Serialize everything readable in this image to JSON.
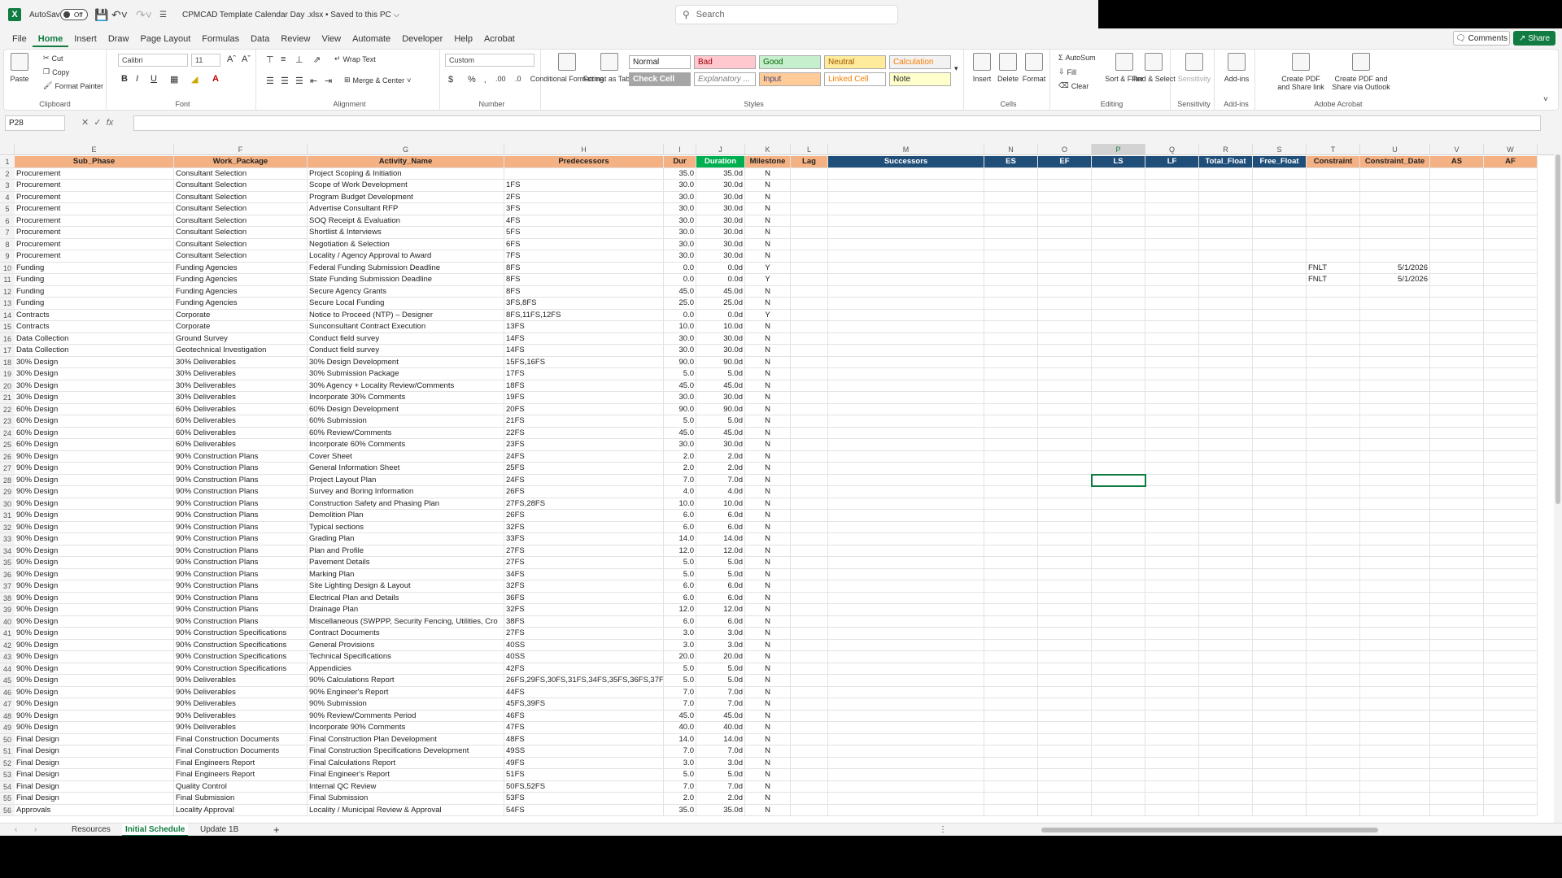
{
  "titlebar": {
    "app_logo": "X",
    "autosave_label": "AutoSave",
    "autosave_state": "Off",
    "doc_title": "CPMCAD Template Calendar Day .xlsx • Saved to this PC ⌵",
    "search_placeholder": "Search",
    "comments": "Comments",
    "share": "Share"
  },
  "menu": [
    "File",
    "Home",
    "Insert",
    "Draw",
    "Page Layout",
    "Formulas",
    "Data",
    "Review",
    "View",
    "Automate",
    "Developer",
    "Help",
    "Acrobat"
  ],
  "ribbon": {
    "clipboard": {
      "paste": "Paste",
      "cut": "Cut",
      "copy": "Copy",
      "format_painter": "Format Painter",
      "label": "Clipboard"
    },
    "font": {
      "name": "Calibri",
      "size": "11",
      "label": "Font"
    },
    "alignment": {
      "wrap": "Wrap Text",
      "merge": "Merge & Center",
      "label": "Alignment"
    },
    "number": {
      "format": "Custom",
      "label": "Number"
    },
    "styles": {
      "cond": "Conditional Formatting",
      "table": "Format as Table",
      "label": "Styles",
      "cells": [
        "Normal",
        "Bad",
        "Good",
        "Neutral",
        "Calculation",
        "Check Cell",
        "Explanatory ...",
        "Input",
        "Linked Cell",
        "Note"
      ]
    },
    "cells": {
      "insert": "Insert",
      "delete": "Delete",
      "format": "Format",
      "label": "Cells"
    },
    "editing": {
      "autosum": "AutoSum",
      "fill": "Fill",
      "clear": "Clear",
      "sort": "Sort & Filter",
      "find": "Find & Select",
      "label": "Editing"
    },
    "sensitivity": {
      "btn": "Sensitivity",
      "label": "Sensitivity"
    },
    "addins": {
      "btn": "Add-ins",
      "label": "Add-ins"
    },
    "acrobat": {
      "pdf": "Create PDF and Share link",
      "pdf_outlook": "Create PDF and Share via Outlook",
      "label": "Adobe Acrobat"
    }
  },
  "formula_bar": {
    "namebox": "P28",
    "fx": "fx"
  },
  "columns": [
    "E",
    "F",
    "G",
    "H",
    "I",
    "J",
    "K",
    "L",
    "M",
    "N",
    "O",
    "P",
    "Q",
    "R",
    "S",
    "T",
    "U",
    "V",
    "W"
  ],
  "headers": [
    "Sub_Phase",
    "Work_Package",
    "Activity_Name",
    "Predecessors",
    "Dur",
    "Duration",
    "Milestone",
    "Lag",
    "Successors",
    "ES",
    "EF",
    "LS",
    "LF",
    "Total_Float",
    "Free_Float",
    "Constraint",
    "Constraint_Date",
    "AS",
    "AF"
  ],
  "rows": [
    [
      "Procurement",
      "Consultant Selection",
      "Project Scoping & Initiation",
      "",
      "35.0",
      "35.0d",
      "N"
    ],
    [
      "Procurement",
      "Consultant Selection",
      "Scope of Work Development",
      "1FS",
      "30.0",
      "30.0d",
      "N"
    ],
    [
      "Procurement",
      "Consultant Selection",
      "Program Budget Development",
      "2FS",
      "30.0",
      "30.0d",
      "N"
    ],
    [
      "Procurement",
      "Consultant Selection",
      "Advertise Consultant RFP",
      "3FS",
      "30.0",
      "30.0d",
      "N"
    ],
    [
      "Procurement",
      "Consultant Selection",
      "SOQ Receipt & Evaluation",
      "4FS",
      "30.0",
      "30.0d",
      "N"
    ],
    [
      "Procurement",
      "Consultant Selection",
      "Shortlist & Interviews",
      "5FS",
      "30.0",
      "30.0d",
      "N"
    ],
    [
      "Procurement",
      "Consultant Selection",
      "Negotiation & Selection",
      "6FS",
      "30.0",
      "30.0d",
      "N"
    ],
    [
      "Procurement",
      "Consultant Selection",
      "Locality / Agency Approval to Award",
      "7FS",
      "30.0",
      "30.0d",
      "N"
    ],
    [
      "Funding",
      "Funding Agencies",
      "Federal Funding Submission Deadline",
      "8FS",
      "0.0",
      "0.0d",
      "Y",
      "FNLT",
      "5/1/2026"
    ],
    [
      "Funding",
      "Funding Agencies",
      "State Funding Submission Deadline",
      "8FS",
      "0.0",
      "0.0d",
      "Y",
      "FNLT",
      "5/1/2026"
    ],
    [
      "Funding",
      "Funding Agencies",
      "Secure Agency Grants",
      "8FS",
      "45.0",
      "45.0d",
      "N"
    ],
    [
      "Funding",
      "Funding Agencies",
      "Secure Local Funding",
      "3FS,8FS",
      "25.0",
      "25.0d",
      "N"
    ],
    [
      "Contracts",
      "Corporate",
      "Notice to Proceed (NTP) – Designer",
      "8FS,11FS,12FS",
      "0.0",
      "0.0d",
      "Y"
    ],
    [
      "Contracts",
      "Corporate",
      "Sunconsultant Contract Execution",
      "13FS",
      "10.0",
      "10.0d",
      "N"
    ],
    [
      "Data Collection",
      "Ground Survey",
      "Conduct field survey",
      "14FS",
      "30.0",
      "30.0d",
      "N"
    ],
    [
      "Data Collection",
      "Geotechnical Investigation",
      "Conduct field survey",
      "14FS",
      "30.0",
      "30.0d",
      "N"
    ],
    [
      "30% Design",
      "30% Deliverables",
      "30% Design Development",
      "15FS,16FS",
      "90.0",
      "90.0d",
      "N"
    ],
    [
      "30% Design",
      "30% Deliverables",
      "30% Submission Package",
      "17FS",
      "5.0",
      "5.0d",
      "N"
    ],
    [
      "30% Design",
      "30% Deliverables",
      "30% Agency + Locality Review/Comments",
      "18FS",
      "45.0",
      "45.0d",
      "N"
    ],
    [
      "30% Design",
      "30% Deliverables",
      "Incorporate 30% Comments",
      "19FS",
      "30.0",
      "30.0d",
      "N"
    ],
    [
      "60% Design",
      "60% Deliverables",
      "60% Design Development",
      "20FS",
      "90.0",
      "90.0d",
      "N"
    ],
    [
      "60% Design",
      "60% Deliverables",
      "60% Submission",
      "21FS",
      "5.0",
      "5.0d",
      "N"
    ],
    [
      "60% Design",
      "60% Deliverables",
      "60% Review/Comments",
      "22FS",
      "45.0",
      "45.0d",
      "N"
    ],
    [
      "60% Design",
      "60% Deliverables",
      "Incorporate 60% Comments",
      "23FS",
      "30.0",
      "30.0d",
      "N"
    ],
    [
      "90% Design",
      "90% Construction Plans",
      "Cover Sheet",
      "24FS",
      "2.0",
      "2.0d",
      "N"
    ],
    [
      "90% Design",
      "90% Construction Plans",
      "General Information Sheet",
      "25FS",
      "2.0",
      "2.0d",
      "N"
    ],
    [
      "90% Design",
      "90% Construction Plans",
      "Project Layout Plan",
      "24FS",
      "7.0",
      "7.0d",
      "N"
    ],
    [
      "90% Design",
      "90% Construction Plans",
      "Survey and Boring Information",
      "26FS",
      "4.0",
      "4.0d",
      "N"
    ],
    [
      "90% Design",
      "90% Construction Plans",
      "Construction Safety and Phasing Plan",
      "27FS,28FS",
      "10.0",
      "10.0d",
      "N"
    ],
    [
      "90% Design",
      "90% Construction Plans",
      "Demolition Plan",
      "26FS",
      "6.0",
      "6.0d",
      "N"
    ],
    [
      "90% Design",
      "90% Construction Plans",
      "Typical sections",
      "32FS",
      "6.0",
      "6.0d",
      "N"
    ],
    [
      "90% Design",
      "90% Construction Plans",
      "Grading Plan",
      "33FS",
      "14.0",
      "14.0d",
      "N"
    ],
    [
      "90% Design",
      "90% Construction Plans",
      "Plan and Profile",
      "27FS",
      "12.0",
      "12.0d",
      "N"
    ],
    [
      "90% Design",
      "90% Construction Plans",
      "Pavement Details",
      "27FS",
      "5.0",
      "5.0d",
      "N"
    ],
    [
      "90% Design",
      "90% Construction Plans",
      "Marking Plan",
      "34FS",
      "5.0",
      "5.0d",
      "N"
    ],
    [
      "90% Design",
      "90% Construction Plans",
      "Site Lighting Design & Layout",
      "32FS",
      "6.0",
      "6.0d",
      "N"
    ],
    [
      "90% Design",
      "90% Construction Plans",
      "Electrical Plan and Details",
      "36FS",
      "6.0",
      "6.0d",
      "N"
    ],
    [
      "90% Design",
      "90% Construction Plans",
      "Drainage Plan",
      "32FS",
      "12.0",
      "12.0d",
      "N"
    ],
    [
      "90% Design",
      "90% Construction Plans",
      "Miscellaneous (SWPPP, Security Fencing, Utilities, Cro",
      "38FS",
      "6.0",
      "6.0d",
      "N"
    ],
    [
      "90% Design",
      "90% Construction Specifications",
      "Contract Documents",
      "27FS",
      "3.0",
      "3.0d",
      "N"
    ],
    [
      "90% Design",
      "90% Construction Specifications",
      "General Provisions",
      "40SS",
      "3.0",
      "3.0d",
      "N"
    ],
    [
      "90% Design",
      "90% Construction Specifications",
      "Technical Specifications",
      "40SS",
      "20.0",
      "20.0d",
      "N"
    ],
    [
      "90% Design",
      "90% Construction Specifications",
      "Appendicies",
      "42FS",
      "5.0",
      "5.0d",
      "N"
    ],
    [
      "90% Design",
      "90% Deliverables",
      "90% Calculations Report",
      "26FS,29FS,30FS,31FS,34FS,35FS,36FS,37FS,3",
      "5.0",
      "5.0d",
      "N"
    ],
    [
      "90% Design",
      "90% Deliverables",
      "90% Engineer's Report",
      "44FS",
      "7.0",
      "7.0d",
      "N"
    ],
    [
      "90% Design",
      "90% Deliverables",
      "90% Submission",
      "45FS,39FS",
      "7.0",
      "7.0d",
      "N"
    ],
    [
      "90% Design",
      "90% Deliverables",
      "90% Review/Comments Period",
      "46FS",
      "45.0",
      "45.0d",
      "N"
    ],
    [
      "90% Design",
      "90% Deliverables",
      "Incorporate 90% Comments",
      "47FS",
      "40.0",
      "40.0d",
      "N"
    ],
    [
      "Final Design",
      "Final Construction Documents",
      "Final Construction Plan Development",
      "48FS",
      "14.0",
      "14.0d",
      "N"
    ],
    [
      "Final Design",
      "Final Construction Documents",
      "Final Construction Specifications Development",
      "49SS",
      "7.0",
      "7.0d",
      "N"
    ],
    [
      "Final Design",
      "Final Engineers Report",
      "Final Calculations Report",
      "49FS",
      "3.0",
      "3.0d",
      "N"
    ],
    [
      "Final Design",
      "Final Engineers Report",
      "Final Engineer's Report",
      "51FS",
      "5.0",
      "5.0d",
      "N"
    ],
    [
      "Final Design",
      "Quality Control",
      "Internal QC Review",
      "50FS,52FS",
      "7.0",
      "7.0d",
      "N"
    ],
    [
      "Final Design",
      "Final Submission",
      "Final Submission",
      "53FS",
      "2.0",
      "2.0d",
      "N"
    ],
    [
      "Approvals",
      "Locality Approval",
      "Locality / Municipal Review & Approval",
      "54FS",
      "35.0",
      "35.0d",
      "N"
    ]
  ],
  "sheet_tabs": [
    "Resources",
    "Initial Schedule",
    "Update 1B"
  ],
  "colors": {
    "excel_green": "#107c41",
    "header_orange": "#f4b183",
    "header_green": "#00b050",
    "header_blue": "#1f4e79"
  }
}
